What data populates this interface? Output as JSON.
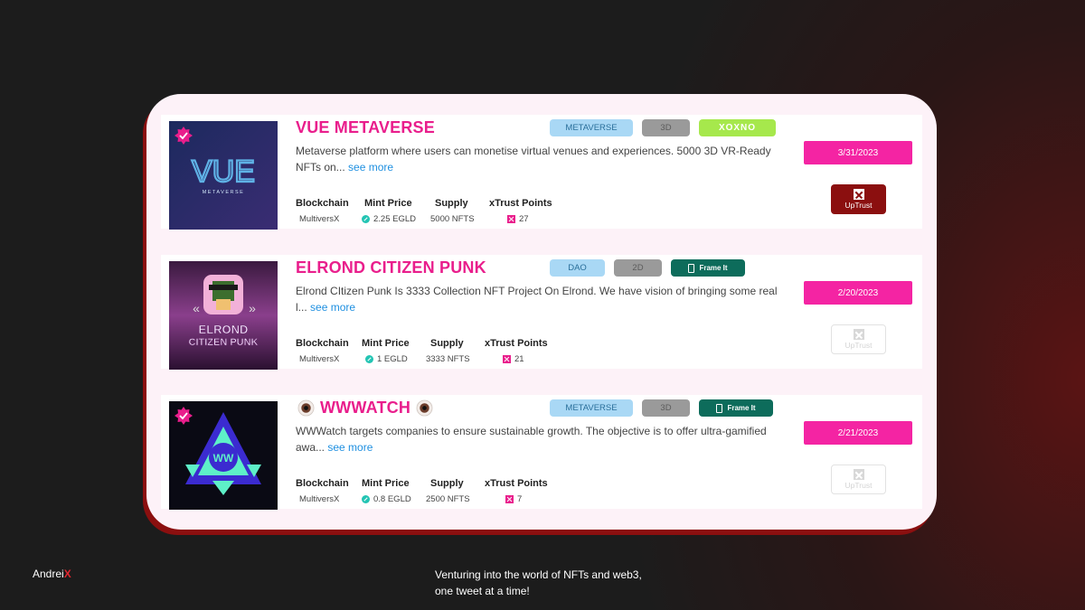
{
  "projects": [
    {
      "title": "VUE METAVERSE",
      "description": "Metaverse platform where users can monetise virtual venues and experiences. 5000 3D VR-Ready NFTs on...",
      "see_more": "see more",
      "tags": [
        "METAVERSE",
        "3D",
        "XOXNO"
      ],
      "stats_headers": [
        "Blockchain",
        "Mint Price",
        "Supply",
        "xTrust Points"
      ],
      "blockchain": "MultiversX",
      "mint_price": "2.25 EGLD",
      "supply": "5000 NFTS",
      "xtrust_points": "27",
      "date": "3/31/2023",
      "uptrust_label": "UpTrust",
      "thumb_text": "VUE",
      "thumb_subtext": "METAVERSE"
    },
    {
      "title": "ELROND CITIZEN PUNK",
      "description": "Elrond CItizen Punk Is 3333 Collection NFT Project On Elrond. We have vision of bringing some real l...",
      "see_more": "see more",
      "tags": [
        "DAO",
        "2D",
        "Frame It"
      ],
      "stats_headers": [
        "Blockchain",
        "Mint Price",
        "Supply",
        "xTrust Points"
      ],
      "blockchain": "MultiversX",
      "mint_price": "1 EGLD",
      "supply": "3333 NFTS",
      "xtrust_points": "21",
      "date": "2/20/2023",
      "uptrust_label": "UpTrust",
      "thumb_text": "ELROND",
      "thumb_subtext": "CITIZEN PUNK"
    },
    {
      "title": "WWWATCH",
      "description": "WWWatch targets companies to ensure sustainable growth. The objective is to offer ultra-gamified awa...",
      "see_more": "see more",
      "tags": [
        "METAVERSE",
        "3D",
        "Frame It"
      ],
      "stats_headers": [
        "Blockchain",
        "Mint Price",
        "Supply",
        "xTrust Points"
      ],
      "blockchain": "MultiversX",
      "mint_price": "0.8 EGLD",
      "supply": "2500 NFTS",
      "xtrust_points": "7",
      "date": "2/21/2023",
      "uptrust_label": "UpTrust",
      "thumb_text": "WW"
    }
  ],
  "footer": {
    "brand_name": "Andrei",
    "brand_mark": "X",
    "tagline_line1": "Venturing into the world of NFTs and web3,",
    "tagline_line2": "one tweet at a time!"
  },
  "colors": {
    "accent_pink": "#e91e8c",
    "date_pink": "#f424a3",
    "uptrust_red": "#8b0f0f",
    "frame_green": "#0d6c5b",
    "xoxno_green": "#a6e84c",
    "tag_blue": "#a9d8f5"
  },
  "icons": [
    "verified-badge-icon",
    "egld-icon",
    "xtrust-icon",
    "uptrust-icon",
    "frame-icon",
    "eye-icon"
  ]
}
